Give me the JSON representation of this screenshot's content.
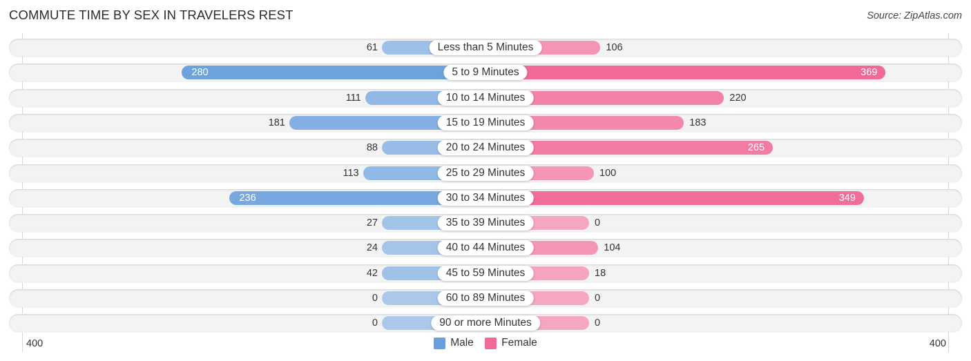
{
  "chart_data": {
    "type": "bar",
    "orientation": "horizontal-diverging",
    "title": "COMMUTE TIME BY SEX IN TRAVELERS REST",
    "source": "Source: ZipAtlas.com",
    "categories": [
      "Less than 5 Minutes",
      "5 to 9 Minutes",
      "10 to 14 Minutes",
      "15 to 19 Minutes",
      "20 to 24 Minutes",
      "25 to 29 Minutes",
      "30 to 34 Minutes",
      "35 to 39 Minutes",
      "40 to 44 Minutes",
      "45 to 59 Minutes",
      "60 to 89 Minutes",
      "90 or more Minutes"
    ],
    "series": [
      {
        "name": "Male",
        "color": "#6a9fdc",
        "values": [
          61,
          280,
          111,
          181,
          88,
          113,
          236,
          27,
          24,
          42,
          0,
          0
        ]
      },
      {
        "name": "Female",
        "color": "#f06a95",
        "values": [
          106,
          369,
          220,
          183,
          265,
          100,
          349,
          0,
          104,
          18,
          0,
          0
        ]
      }
    ],
    "xlim": [
      -400,
      400
    ],
    "axis_ticks": {
      "left": "400",
      "right": "400"
    },
    "legend": {
      "position": "bottom-center",
      "items": [
        "Male",
        "Female"
      ]
    },
    "grid": false
  },
  "colors": {
    "male_strong": "#6a9fdc",
    "male_light": "#a9c8ea",
    "female_strong": "#f06a95",
    "female_light": "#f5a6c0",
    "row_bg": "#f3f3f3"
  }
}
